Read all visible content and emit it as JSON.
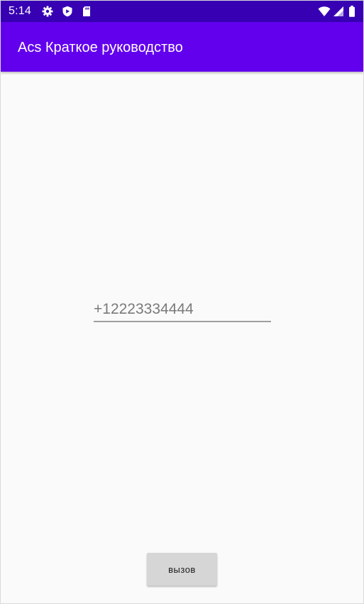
{
  "status_bar": {
    "time": "5:14",
    "left_icons": [
      "gear-icon",
      "shield-icon",
      "sd-card-icon"
    ],
    "right_icons": [
      "wifi-icon",
      "signal-icon",
      "battery-icon"
    ],
    "background": "#3700b3"
  },
  "app_bar": {
    "title": "Acs Краткое руководство",
    "background": "#6200ee"
  },
  "phone_input": {
    "placeholder": "+12223334444",
    "value": ""
  },
  "call_button": {
    "label": "вызов"
  }
}
